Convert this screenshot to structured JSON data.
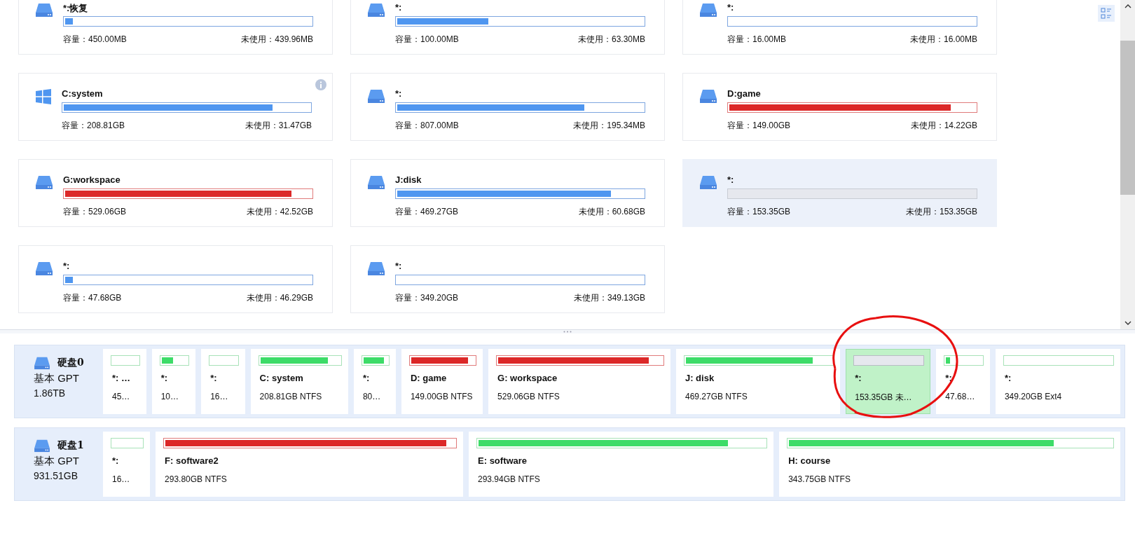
{
  "partitions": [
    {
      "title": "*:恢复",
      "kind": "drive",
      "info": false,
      "full": false,
      "unallocated": false,
      "selected": false,
      "level": 0.03,
      "capacity": "容量：450.00MB",
      "unused": "未使用：439.96MB"
    },
    {
      "title": "*:",
      "kind": "drive",
      "info": false,
      "full": false,
      "unallocated": false,
      "selected": false,
      "level": 0.37,
      "capacity": "容量：100.00MB",
      "unused": "未使用：63.30MB"
    },
    {
      "title": "*:",
      "kind": "drive",
      "info": false,
      "full": false,
      "unallocated": false,
      "selected": false,
      "level": 0,
      "capacity": "容量：16.00MB",
      "unused": "未使用：16.00MB"
    },
    {
      "title": "C:system",
      "kind": "windows",
      "info": true,
      "full": false,
      "unallocated": false,
      "selected": false,
      "level": 0.85,
      "capacity": "容量：208.81GB",
      "unused": "未使用：31.47GB"
    },
    {
      "title": "*:",
      "kind": "drive",
      "info": false,
      "full": false,
      "unallocated": false,
      "selected": false,
      "level": 0.76,
      "capacity": "容量：807.00MB",
      "unused": "未使用：195.34MB"
    },
    {
      "title": "D:game",
      "kind": "drive",
      "info": false,
      "full": true,
      "unallocated": false,
      "selected": false,
      "level": 0.9,
      "capacity": "容量：149.00GB",
      "unused": "未使用：14.22GB"
    },
    {
      "title": "G:workspace",
      "kind": "drive",
      "info": false,
      "full": true,
      "unallocated": false,
      "selected": false,
      "level": 0.92,
      "capacity": "容量：529.06GB",
      "unused": "未使用：42.52GB"
    },
    {
      "title": "J:disk",
      "kind": "drive",
      "info": false,
      "full": false,
      "unallocated": false,
      "selected": false,
      "level": 0.87,
      "capacity": "容量：469.27GB",
      "unused": "未使用：60.68GB"
    },
    {
      "title": "*:",
      "kind": "drive",
      "info": false,
      "unallocated": true,
      "selected": true,
      "level": 0,
      "capacity": "容量：153.35GB",
      "unused": "未使用：153.35GB"
    },
    {
      "title": "*:",
      "kind": "drive",
      "info": false,
      "full": false,
      "unallocated": false,
      "selected": false,
      "level": 0.03,
      "capacity": "容量：47.68GB",
      "unused": "未使用：46.29GB"
    },
    {
      "title": "*:",
      "kind": "drive",
      "info": false,
      "full": false,
      "unallocated": false,
      "selected": false,
      "level": 0,
      "capacity": "容量：349.20GB",
      "unused": "未使用：349.13GB"
    }
  ],
  "disks": [
    {
      "name": "硬盘0",
      "type": "基本 GPT",
      "size": "1.86TB",
      "partitions": [
        {
          "label": "*: …",
          "detail": "45…",
          "full": false,
          "unallocated": false,
          "selected": false,
          "level": 0
        },
        {
          "label": "*:",
          "detail": "10…",
          "full": false,
          "unallocated": false,
          "selected": false,
          "level": 0.45
        },
        {
          "label": "*:",
          "detail": "16…",
          "full": false,
          "unallocated": false,
          "selected": false,
          "level": 0
        },
        {
          "label": "C: system",
          "detail": "208.81GB NTFS",
          "full": false,
          "unallocated": false,
          "selected": false,
          "level": 0.85
        },
        {
          "label": "*:",
          "detail": "80…",
          "full": false,
          "unallocated": false,
          "selected": false,
          "level": 0.85
        },
        {
          "label": "D: game",
          "detail": "149.00GB NTFS",
          "full": true,
          "unallocated": false,
          "selected": false,
          "level": 0.9
        },
        {
          "label": "G: workspace",
          "detail": "529.06GB NTFS",
          "full": true,
          "unallocated": false,
          "selected": false,
          "level": 0.92
        },
        {
          "label": "J: disk",
          "detail": "469.27GB NTFS",
          "full": false,
          "unallocated": false,
          "selected": false,
          "level": 0.87
        },
        {
          "label": "*:",
          "detail": "153.35GB 未…",
          "unallocated": true,
          "selected": true,
          "level": 0
        },
        {
          "label": "*:",
          "detail": "47.68…",
          "full": false,
          "unallocated": false,
          "selected": false,
          "level": 0.12
        },
        {
          "label": "*:",
          "detail": "349.20GB Ext4",
          "full": false,
          "unallocated": false,
          "selected": false,
          "level": 0
        }
      ]
    },
    {
      "name": "硬盘1",
      "type": "基本 GPT",
      "size": "931.51GB",
      "partitions": [
        {
          "label": "*:",
          "detail": "16…",
          "full": false,
          "unallocated": false,
          "selected": false,
          "level": 0
        },
        {
          "label": "F: software2",
          "detail": "293.80GB NTFS",
          "full": true,
          "unallocated": false,
          "selected": false,
          "level": 0.97
        },
        {
          "label": "E: software",
          "detail": "293.94GB NTFS",
          "full": false,
          "unallocated": false,
          "selected": false,
          "level": 0.87
        },
        {
          "label": "H: course",
          "detail": "343.75GB NTFS",
          "full": false,
          "unallocated": false,
          "selected": false,
          "level": 0.82
        }
      ]
    }
  ]
}
